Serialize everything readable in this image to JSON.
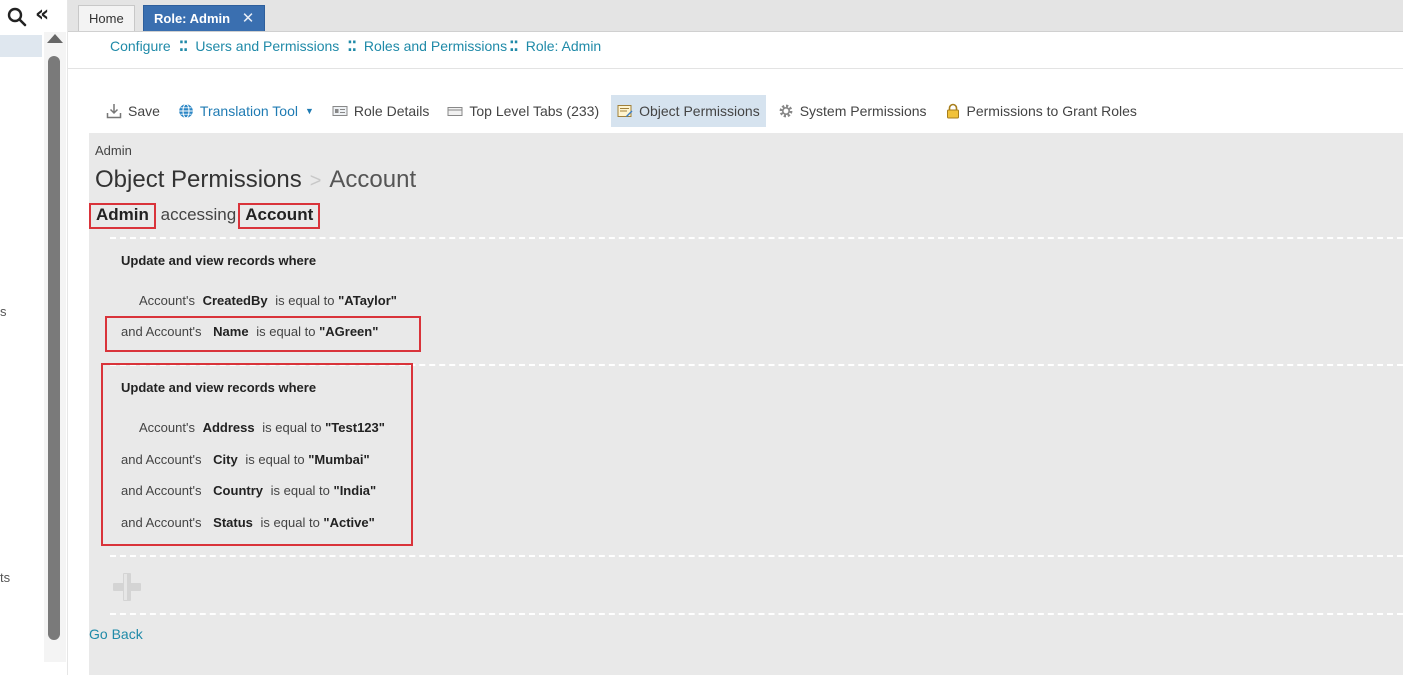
{
  "rail": {
    "fragment_1": "s",
    "fragment_2": "ts"
  },
  "tabs": {
    "home": "Home",
    "active": "Role: Admin",
    "close_glyph": "✕"
  },
  "breadcrumb": [
    "Configure",
    "Users and Permissions",
    "Roles and Permissions",
    "Role: Admin"
  ],
  "breadcrumb_separator": "⁚⁚",
  "toolbar": {
    "save": "Save",
    "translation": "Translation Tool",
    "role_details": "Role Details",
    "top_level_tabs": "Top Level Tabs (233)",
    "object_permissions": "Object Permissions",
    "system_permissions": "System Permissions",
    "grant_roles": "Permissions to Grant Roles"
  },
  "panel": {
    "role_name": "Admin",
    "title": "Object Permissions",
    "title_sep": ">",
    "title_object": "Account",
    "access_subject": "Admin",
    "access_verb": "accessing",
    "access_object": "Account"
  },
  "rules": [
    {
      "heading": "Update and view records where",
      "conditions": [
        {
          "prefix": "Account's",
          "field": "CreatedBy",
          "op": "is equal to",
          "value": "\"ATaylor\""
        },
        {
          "prefix": "and Account's",
          "field": "Name",
          "op": "is equal to",
          "value": "\"AGreen\""
        }
      ]
    },
    {
      "heading": "Update and view records where",
      "conditions": [
        {
          "prefix": "Account's",
          "field": "Address",
          "op": "is equal to",
          "value": "\"Test123\""
        },
        {
          "prefix": "and Account's",
          "field": "City",
          "op": "is equal to",
          "value": "\"Mumbai\""
        },
        {
          "prefix": "and Account's",
          "field": "Country",
          "op": "is equal to",
          "value": "\"India\""
        },
        {
          "prefix": "and Account's",
          "field": "Status",
          "op": "is equal to",
          "value": "\"Active\""
        }
      ]
    }
  ],
  "go_back": "Go Back",
  "colors": {
    "accent_tab": "#3a6fb0",
    "link": "#1f8aa8",
    "highlight_box": "#d9333a",
    "panel_bg": "#e9e9e9"
  }
}
